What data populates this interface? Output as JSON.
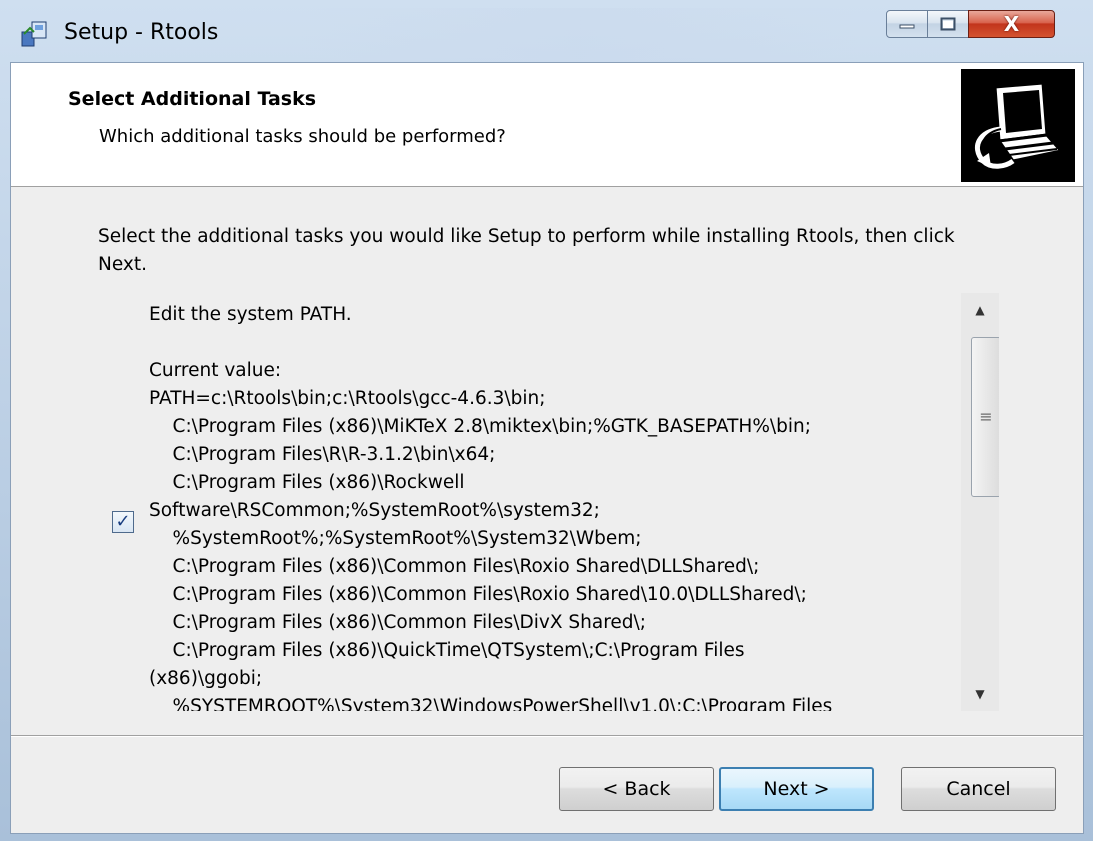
{
  "window": {
    "title": "Setup - Rtools",
    "close_glyph": "X"
  },
  "header": {
    "title": "Select Additional Tasks",
    "subtitle": "Which additional tasks should be performed?"
  },
  "intro_text": "Select the additional tasks you would like Setup to perform while installing Rtools, then click Next.",
  "task": {
    "checked": true,
    "lines": "Edit the system PATH.\n\nCurrent value:\nPATH=c:\\Rtools\\bin;c:\\Rtools\\gcc-4.6.3\\bin;\n    C:\\Program Files (x86)\\MiKTeX 2.8\\miktex\\bin;%GTK_BASEPATH%\\bin;\n    C:\\Program Files\\R\\R-3.1.2\\bin\\x64;\n    C:\\Program Files (x86)\\Rockwell\nSoftware\\RSCommon;%SystemRoot%\\system32;\n    %SystemRoot%;%SystemRoot%\\System32\\Wbem;\n    C:\\Program Files (x86)\\Common Files\\Roxio Shared\\DLLShared\\;\n    C:\\Program Files (x86)\\Common Files\\Roxio Shared\\10.0\\DLLShared\\;\n    C:\\Program Files (x86)\\Common Files\\DivX Shared\\;\n    C:\\Program Files (x86)\\QuickTime\\QTSystem\\;C:\\Program Files\n(x86)\\ggobi;\n    %SYSTEMROOT%\\System32\\WindowsPowerShell\\v1.0\\;C:\\Program Files"
  },
  "buttons": {
    "back": "< Back",
    "next": "Next >",
    "cancel": "Cancel"
  },
  "colors": {
    "close_button": "#c2341c",
    "default_button_border": "#3c7fb1"
  }
}
